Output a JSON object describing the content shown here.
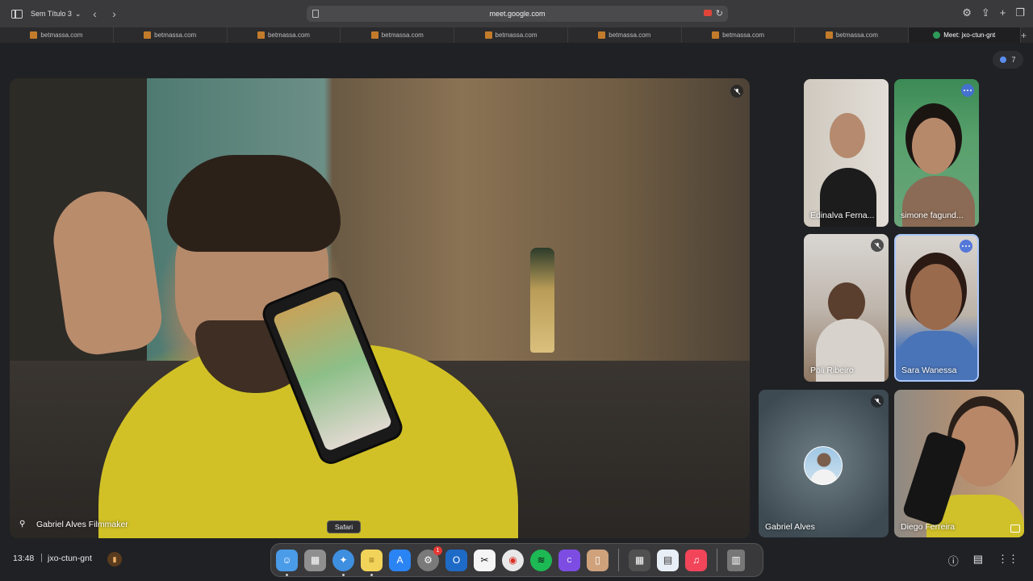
{
  "browser": {
    "tab_group_label": "Sem Título 3",
    "url": "meet.google.com",
    "tabs": [
      {
        "label": "betmassa.com"
      },
      {
        "label": "betmassa.com"
      },
      {
        "label": "betmassa.com"
      },
      {
        "label": "betmassa.com"
      },
      {
        "label": "betmassa.com"
      },
      {
        "label": "betmassa.com"
      },
      {
        "label": "betmassa.com"
      },
      {
        "label": "betmassa.com"
      },
      {
        "label": "Meet: jxo-ctun-gnt"
      }
    ],
    "new_tab_icon": "plus-icon"
  },
  "meet": {
    "participant_count": "7",
    "main_speaker": {
      "name": "Gabriel Alves Filmmaker"
    },
    "tiles": [
      {
        "name": "Edinalva Ferna..."
      },
      {
        "name": "simone fagund..."
      },
      {
        "name": "Poli Ribeiro"
      },
      {
        "name": "Sara Wanessa"
      },
      {
        "name": "Gabriel Alves"
      },
      {
        "name": "Diego Ferreira"
      }
    ],
    "time": "13:48",
    "separator": "|",
    "meeting_code": "jxo-ctun-gnt"
  },
  "dock": {
    "tooltip": "Safari",
    "apps": [
      {
        "name": "Finder",
        "icon": "finder-icon",
        "color": "#4a9be8"
      },
      {
        "name": "Launchpad",
        "icon": "launchpad-icon",
        "color": "#8f8f8f"
      },
      {
        "name": "Safari",
        "icon": "safari-icon",
        "color": "#3f8fe0"
      },
      {
        "name": "Notes",
        "icon": "notes-icon",
        "color": "#f2d35a"
      },
      {
        "name": "App Store",
        "icon": "appstore-icon",
        "color": "#2b84f3"
      },
      {
        "name": "System Settings",
        "icon": "settings-icon",
        "color": "#7a7a7a",
        "badge": "1"
      },
      {
        "name": "Outlook",
        "icon": "outlook-icon",
        "color": "#1e6ac7"
      },
      {
        "name": "CapCut",
        "icon": "capcut-icon",
        "color": "#f5f5f5"
      },
      {
        "name": "Chrome",
        "icon": "chrome-icon",
        "color": "#e8e8e8"
      },
      {
        "name": "Spotify",
        "icon": "spotify-icon",
        "color": "#1db954"
      },
      {
        "name": "Canva",
        "icon": "canva-icon",
        "color": "#7d4de3"
      },
      {
        "name": "Preview",
        "icon": "preview-icon",
        "color": "#cfa27c"
      },
      {
        "name": "Calculator",
        "icon": "calculator-icon",
        "color": "#505050"
      },
      {
        "name": "Keka",
        "icon": "keka-icon",
        "color": "#e8eef5"
      },
      {
        "name": "Music",
        "icon": "music-icon",
        "color": "#f2455a"
      },
      {
        "name": "Trash",
        "icon": "trash-icon",
        "color": "#777777"
      }
    ]
  }
}
